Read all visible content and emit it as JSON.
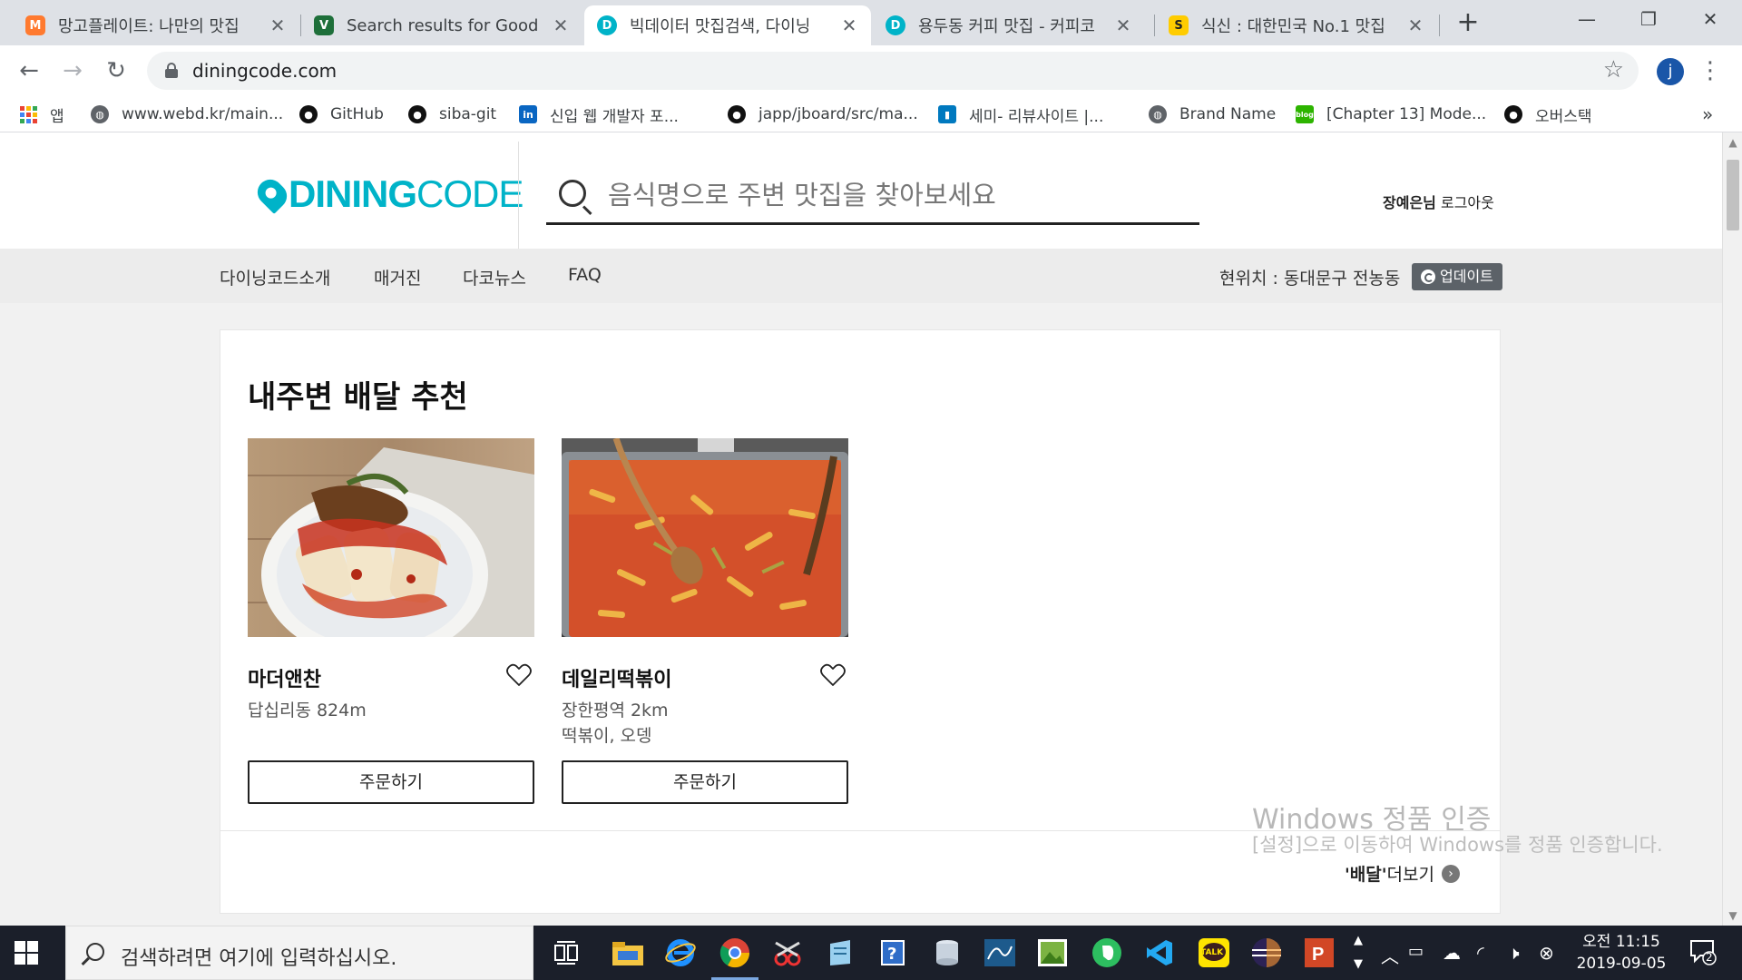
{
  "browser": {
    "tabs": [
      {
        "title": "망고플레이트: 나만의 맛집",
        "favicon_color": "#ff7a2f",
        "favicon_letter": "M"
      },
      {
        "title": "Search results for Good -",
        "favicon_color": "#1e6f3a",
        "favicon_letter": "V"
      },
      {
        "title": "빅데이터 맛집검색, 다이닝",
        "favicon_color": "#00b3c8",
        "favicon_letter": "D"
      },
      {
        "title": "용두동 커피 맛집 - 커피코",
        "favicon_color": "#00b3c8",
        "favicon_letter": "D"
      },
      {
        "title": "식신 : 대한민국 No.1 맛집",
        "favicon_color": "#ffcc00",
        "favicon_letter": "S"
      }
    ],
    "close_glyph": "✕",
    "new_tab_glyph": "+",
    "window_controls": {
      "minimize": "—",
      "restore": "❐",
      "close": "✕"
    },
    "nav": {
      "back": "←",
      "forward": "→",
      "reload": "↻"
    },
    "url": "diningcode.com",
    "star_glyph": "☆",
    "profile_initial": "j",
    "menu_glyph": "⋮"
  },
  "bookmarks": {
    "apps_label": "앱",
    "items": [
      {
        "label": "www.webd.kr/main...",
        "icon": "globe-icon",
        "color": "#5f6368"
      },
      {
        "label": "GitHub",
        "icon": "github-icon",
        "color": "#111111"
      },
      {
        "label": "siba-git",
        "icon": "github-icon",
        "color": "#111111"
      },
      {
        "label": "신입 웹 개발자 포...",
        "icon": "linkedin-icon",
        "color": "#0a66c2"
      },
      {
        "label": "japp/jboard/src/ma...",
        "icon": "github-icon",
        "color": "#111111"
      },
      {
        "label": "세미- 리뷰사이트 |...",
        "icon": "trello-icon",
        "color": "#0079bf"
      },
      {
        "label": "Brand Name",
        "icon": "globe-icon",
        "color": "#5f6368"
      },
      {
        "label": "[Chapter 13] Mode...",
        "icon": "blog-icon",
        "color": "#2db400"
      },
      {
        "label": "오버스택",
        "icon": "github-icon",
        "color": "#111111"
      }
    ],
    "more_glyph": "»"
  },
  "site": {
    "logo": {
      "brand_main": "DINING",
      "brand_sub": "CODE",
      "color": "#00b3c8"
    },
    "search": {
      "placeholder": "음식명으로 주변 맛집을 찾아보세요"
    },
    "user": {
      "name": "장예은님",
      "logout": "로그아웃"
    },
    "nav": [
      "다이닝코드소개",
      "매거진",
      "다코뉴스",
      "FAQ"
    ],
    "location": {
      "label": "현위치 : 동대문구 전농동",
      "update_label": "업데이트"
    }
  },
  "section": {
    "title": "내주변 배달 추천",
    "restaurants": [
      {
        "name": "마더앤찬",
        "location": "답십리동 824m",
        "tags": "",
        "order_label": "주문하기",
        "image": "kkakdugi-photo"
      },
      {
        "name": "데일리떡볶이",
        "location": "장한평역 2km",
        "tags": "떡볶이, 오뎅",
        "order_label": "주문하기",
        "image": "tteokbokki-photo"
      }
    ],
    "more": {
      "quoted": "'배달'",
      "label": " 더보기",
      "arrow": "›"
    }
  },
  "watermark": {
    "title": "Windows 정품 인증",
    "subtitle": "[설정]으로 이동하여 Windows를 정품 인증합니다."
  },
  "taskbar": {
    "search_placeholder": "검색하려면 여기에 입력하십시오.",
    "clock": {
      "ampm_time": "오전 11:15",
      "date": "2019-09-05"
    },
    "notification_count": "2",
    "kakao_label": "TALK"
  }
}
